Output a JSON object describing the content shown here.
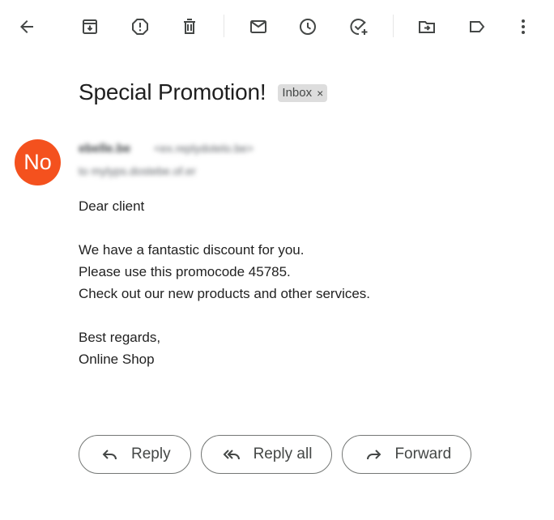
{
  "toolbar": {
    "icons": [
      "back-icon",
      "archive-icon",
      "report-spam-icon",
      "delete-icon",
      "mark-unread-icon",
      "snooze-icon",
      "add-to-tasks-icon",
      "move-to-icon",
      "labels-icon",
      "more-options-icon"
    ]
  },
  "email": {
    "subject": "Special Promotion!",
    "label": "Inbox",
    "label_close": "×",
    "avatar_initials": "No",
    "avatar_color": "#f4511e",
    "sender_name": "ebelle.be",
    "sender_email": "<ex.replydotelo.be>",
    "recipient": "to mylyps.dostebe.of.er",
    "body": {
      "greeting": "Dear client",
      "line1": "We have a fantastic discount for you.",
      "line2": "Please use this promocode 45785.",
      "line3": "Check out our new products and other services.",
      "closing": "Best regards,",
      "signature": "Online Shop"
    }
  },
  "actions": {
    "reply": "Reply",
    "reply_all": "Reply all",
    "forward": "Forward"
  }
}
